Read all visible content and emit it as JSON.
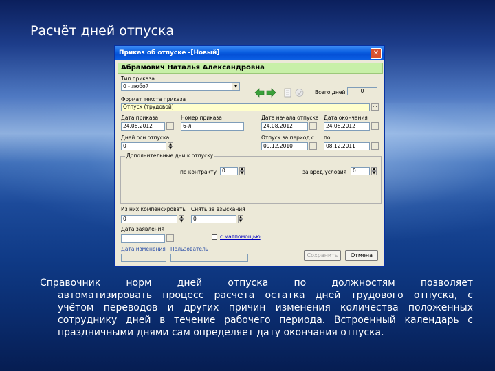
{
  "slide": {
    "title": "Расчёт дней отпуска",
    "description_lines": [
      "Справочник норм дней отпуска по должностям позволяет",
      "автоматизировать процесс расчета остатка дней трудового отпуска, с",
      "учётом переводов и других причин изменения количества положенных",
      "сотруднику дней в течение рабочего периода. Встроенный календарь с",
      "праздничными днями сам определяет дату окончания отпуска."
    ]
  },
  "window": {
    "title": "Приказ об отпуске -[Новый]",
    "employee_name": "Абрамович Наталья Александровна",
    "order_type": {
      "label": "Тип приказа",
      "value": "0 - любой"
    },
    "total_days": {
      "label": "Всего дней",
      "value": "0"
    },
    "text_format": {
      "label": "Формат текста приказа",
      "value": "Отпуск (трудовой)"
    },
    "order_date": {
      "label": "Дата приказа",
      "value": "24.08.2012"
    },
    "order_number": {
      "label": "Номер приказа",
      "value": "6-л"
    },
    "vacation_start": {
      "label": "Дата начала отпуска",
      "value": "24.08.2012"
    },
    "vacation_end": {
      "label": "Дата окончания",
      "value": "24.08.2012"
    },
    "main_days": {
      "label": "Дней осн.отпуска",
      "value": "0"
    },
    "period_from": {
      "label": "Отпуск за период с",
      "value": "09.12.2010"
    },
    "period_to": {
      "label": "по",
      "value": "08.12.2011"
    },
    "additional_group": {
      "label": "Дополнительные дни к отпуску",
      "contract": {
        "label": "по контракту",
        "value": "0"
      },
      "harmful": {
        "label": "за вред.условия",
        "value": "0"
      }
    },
    "compensated": {
      "label": "Из них компенсировать",
      "value": "0"
    },
    "penalty": {
      "label": "Снять за взыскания",
      "value": "0"
    },
    "application_date": {
      "label": "Дата заявления",
      "value": ""
    },
    "material_aid": {
      "label": "с матпомощью"
    },
    "changed_date": {
      "label": "Дата изменения",
      "value": ""
    },
    "user": {
      "label": "Пользователь",
      "value": ""
    },
    "buttons": {
      "save": "Сохранить",
      "cancel": "Отмена"
    }
  }
}
